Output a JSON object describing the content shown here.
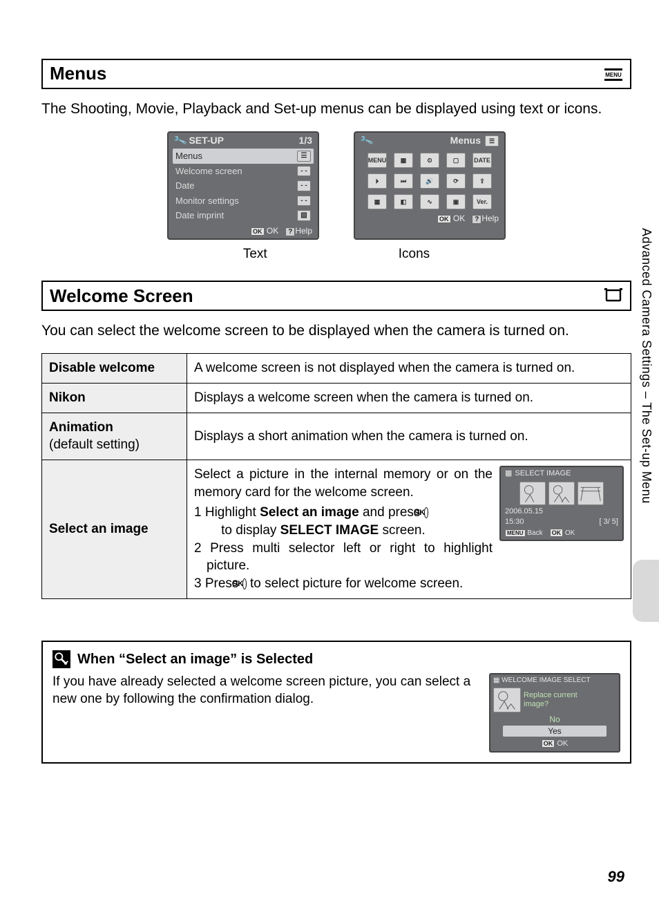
{
  "sidebar_label": "Advanced Camera Settings – The Set-up Menu",
  "page_number": "99",
  "section_menus": {
    "title": "Menus",
    "menu_icon_label": "MENU",
    "intro": "The Shooting, Movie, Playback and Set-up menus can be displayed using text or icons.",
    "text_screen": {
      "header_left": "SET-UP",
      "header_right": "1/3",
      "items": [
        {
          "label": "Menus",
          "value_chip": "☰",
          "selected": true
        },
        {
          "label": "Welcome screen",
          "value_chip": "- -"
        },
        {
          "label": "Date",
          "value_chip": "- -"
        },
        {
          "label": "Monitor settings",
          "value_chip": "- -"
        },
        {
          "label": "Date imprint",
          "value_chip": "▧"
        }
      ],
      "footer_ok": "OK",
      "footer_ok_badge": "OK",
      "footer_help": "Help",
      "footer_help_badge": "?"
    },
    "icons_screen": {
      "header_right": "Menus",
      "footer_ok": "OK",
      "footer_ok_badge": "OK",
      "footer_help": "Help",
      "footer_help_badge": "?",
      "cells": [
        "MENU",
        "▦",
        "⏲",
        "▢",
        "DATE",
        "⏵",
        "⏭",
        "🔊",
        "⟳",
        "⇪",
        "▦",
        "◧",
        "∿",
        "▣",
        "Ver."
      ]
    },
    "caption_left": "Text",
    "caption_right": "Icons"
  },
  "section_welcome": {
    "title": "Welcome Screen",
    "intro": "You can select the welcome screen to be displayed when the camera is turned on.",
    "rows": {
      "disable": {
        "label": "Disable welcome",
        "desc": "A welcome screen is not displayed when the camera is turned on."
      },
      "nikon": {
        "label": "Nikon",
        "desc": "Displays a welcome screen when the camera is turned on."
      },
      "anim": {
        "label": "Animation",
        "sublabel": "(default setting)",
        "desc": "Displays a short animation when the camera is turned on."
      },
      "select": {
        "label": "Select an image",
        "para1": "Select a picture in the internal memory or on the memory card for the welcome screen.",
        "li1a": "1 Highlight ",
        "li1b": "Select an image",
        "li1c": " and press ",
        "li1d": " to display ",
        "li1e": "SELECT IMAGE",
        "li1f": " screen.",
        "li2": "2 Press multi selector left or right to highlight picture.",
        "li3a": "3 Press ",
        "li3b": " to select picture for welcome screen.",
        "ok_glyph": "OK",
        "mini": {
          "title": "SELECT IMAGE",
          "date": "2006.05.15",
          "time": "15:30",
          "counter": "[    3/   5]",
          "back_badge": "MENU",
          "back": "Back",
          "ok_badge": "OK",
          "ok": "OK"
        }
      }
    }
  },
  "note": {
    "title": "When “Select an image” is Selected",
    "text": "If you have already selected a welcome screen picture, you can select a new one by following the confirmation dialog.",
    "mini": {
      "title": "WELCOME IMAGE SELECT",
      "question_l1": "Replace current",
      "question_l2": "image?",
      "opt_no": "No",
      "opt_yes": "Yes",
      "ok_badge": "OK",
      "ok": "OK"
    }
  }
}
